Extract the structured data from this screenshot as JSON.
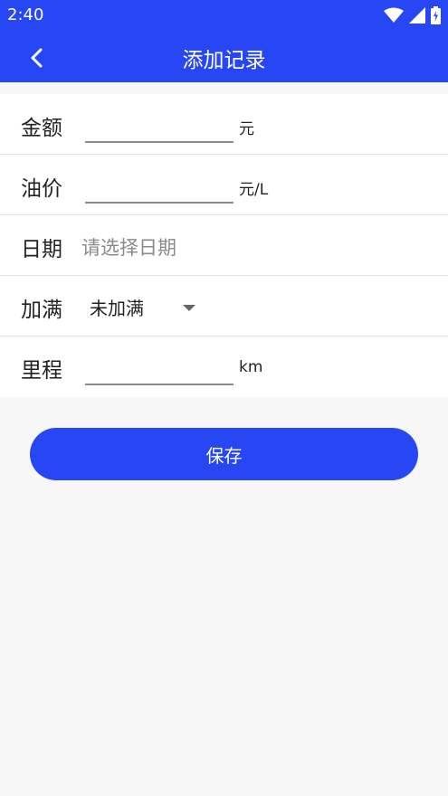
{
  "status_bar": {
    "time": "2:40",
    "icons": [
      "wifi-icon",
      "signal-icon",
      "battery-icon"
    ]
  },
  "app_bar": {
    "back_icon": "chevron-left-icon",
    "title": "添加记录"
  },
  "form": {
    "amount": {
      "label": "金额",
      "value": "",
      "unit": "元"
    },
    "price": {
      "label": "油价",
      "value": "",
      "unit": "元/L"
    },
    "date": {
      "label": "日期",
      "placeholder": "请选择日期"
    },
    "full": {
      "label": "加满",
      "selected": "未加满"
    },
    "mileage": {
      "label": "里程",
      "value": "",
      "unit": "km"
    }
  },
  "actions": {
    "save_label": "保存"
  },
  "colors": {
    "primary": "#2747f5",
    "background": "#f7f7f7"
  }
}
